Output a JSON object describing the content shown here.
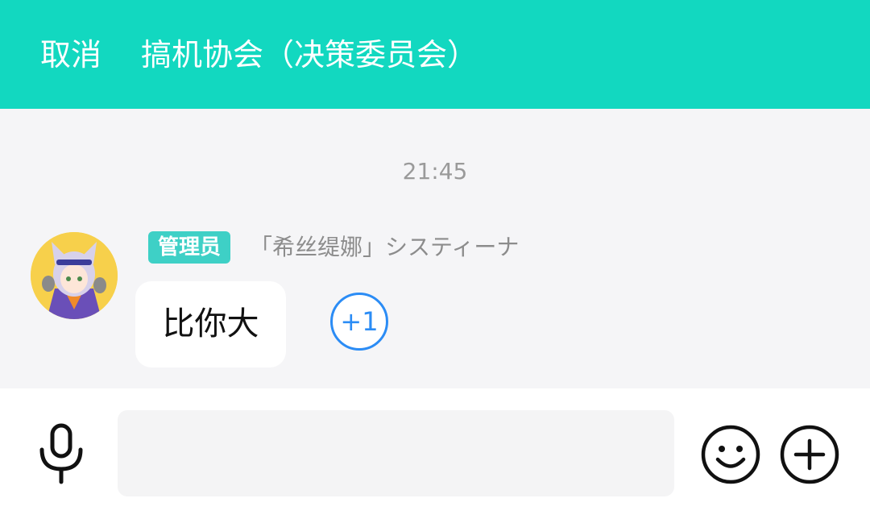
{
  "header": {
    "cancel_label": "取消",
    "title": "搞机协会（决策委员会）"
  },
  "chat": {
    "timestamp": "21:45",
    "messages": [
      {
        "role_badge": "管理员",
        "sender": "「希丝缇娜」システィーナ",
        "text": "比你大",
        "reaction": "+1"
      }
    ]
  },
  "input_bar": {
    "placeholder": "",
    "value": ""
  },
  "icons": {
    "mic": "microphone-icon",
    "emoji": "smiley-icon",
    "more": "plus-circle-icon"
  },
  "colors": {
    "header": "#12d8c0",
    "badge": "#3ed0c6",
    "reaction": "#2b8cf5"
  }
}
